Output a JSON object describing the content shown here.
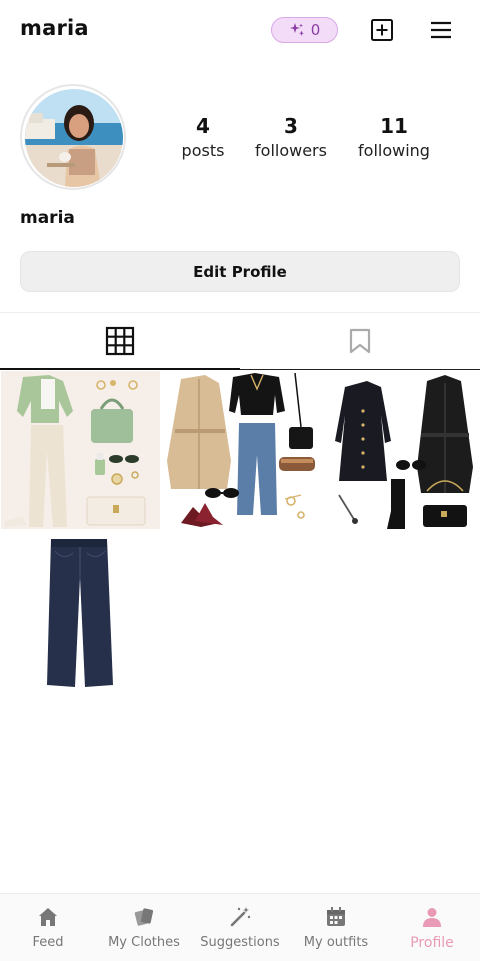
{
  "header": {
    "username": "maria",
    "credits": "0",
    "icons": {
      "credits": "sparkles-icon",
      "add": "plus-square-icon",
      "menu": "hamburger-menu-icon"
    }
  },
  "profile": {
    "name": "maria",
    "avatar_icon": "profile-photo",
    "stats": [
      {
        "value": "4",
        "label": "posts"
      },
      {
        "value": "3",
        "label": "followers"
      },
      {
        "value": "11",
        "label": "following"
      }
    ],
    "edit_label": "Edit Profile"
  },
  "tabs": [
    {
      "icon": "grid-icon",
      "active": true
    },
    {
      "icon": "bookmark-icon",
      "active": false
    }
  ],
  "posts": [
    {
      "icon": "outfit-collage-green"
    },
    {
      "icon": "outfit-collage-trench"
    },
    {
      "icon": "outfit-collage-black"
    },
    {
      "icon": "jeans-photo"
    }
  ],
  "bottom_nav": [
    {
      "label": "Feed",
      "icon": "home-icon",
      "active": false
    },
    {
      "label": "My Clothes",
      "icon": "clothes-icon",
      "active": false
    },
    {
      "label": "Suggestions",
      "icon": "magic-wand-icon",
      "active": false
    },
    {
      "label": "My outfits",
      "icon": "calendar-icon",
      "active": false
    },
    {
      "label": "Profile",
      "icon": "person-icon",
      "active": true
    }
  ],
  "colors": {
    "accent_pink": "#e89ab6",
    "credits_bg": "#f3dcf7",
    "credits_text": "#8a3fa6",
    "button_bg": "#efefef"
  }
}
